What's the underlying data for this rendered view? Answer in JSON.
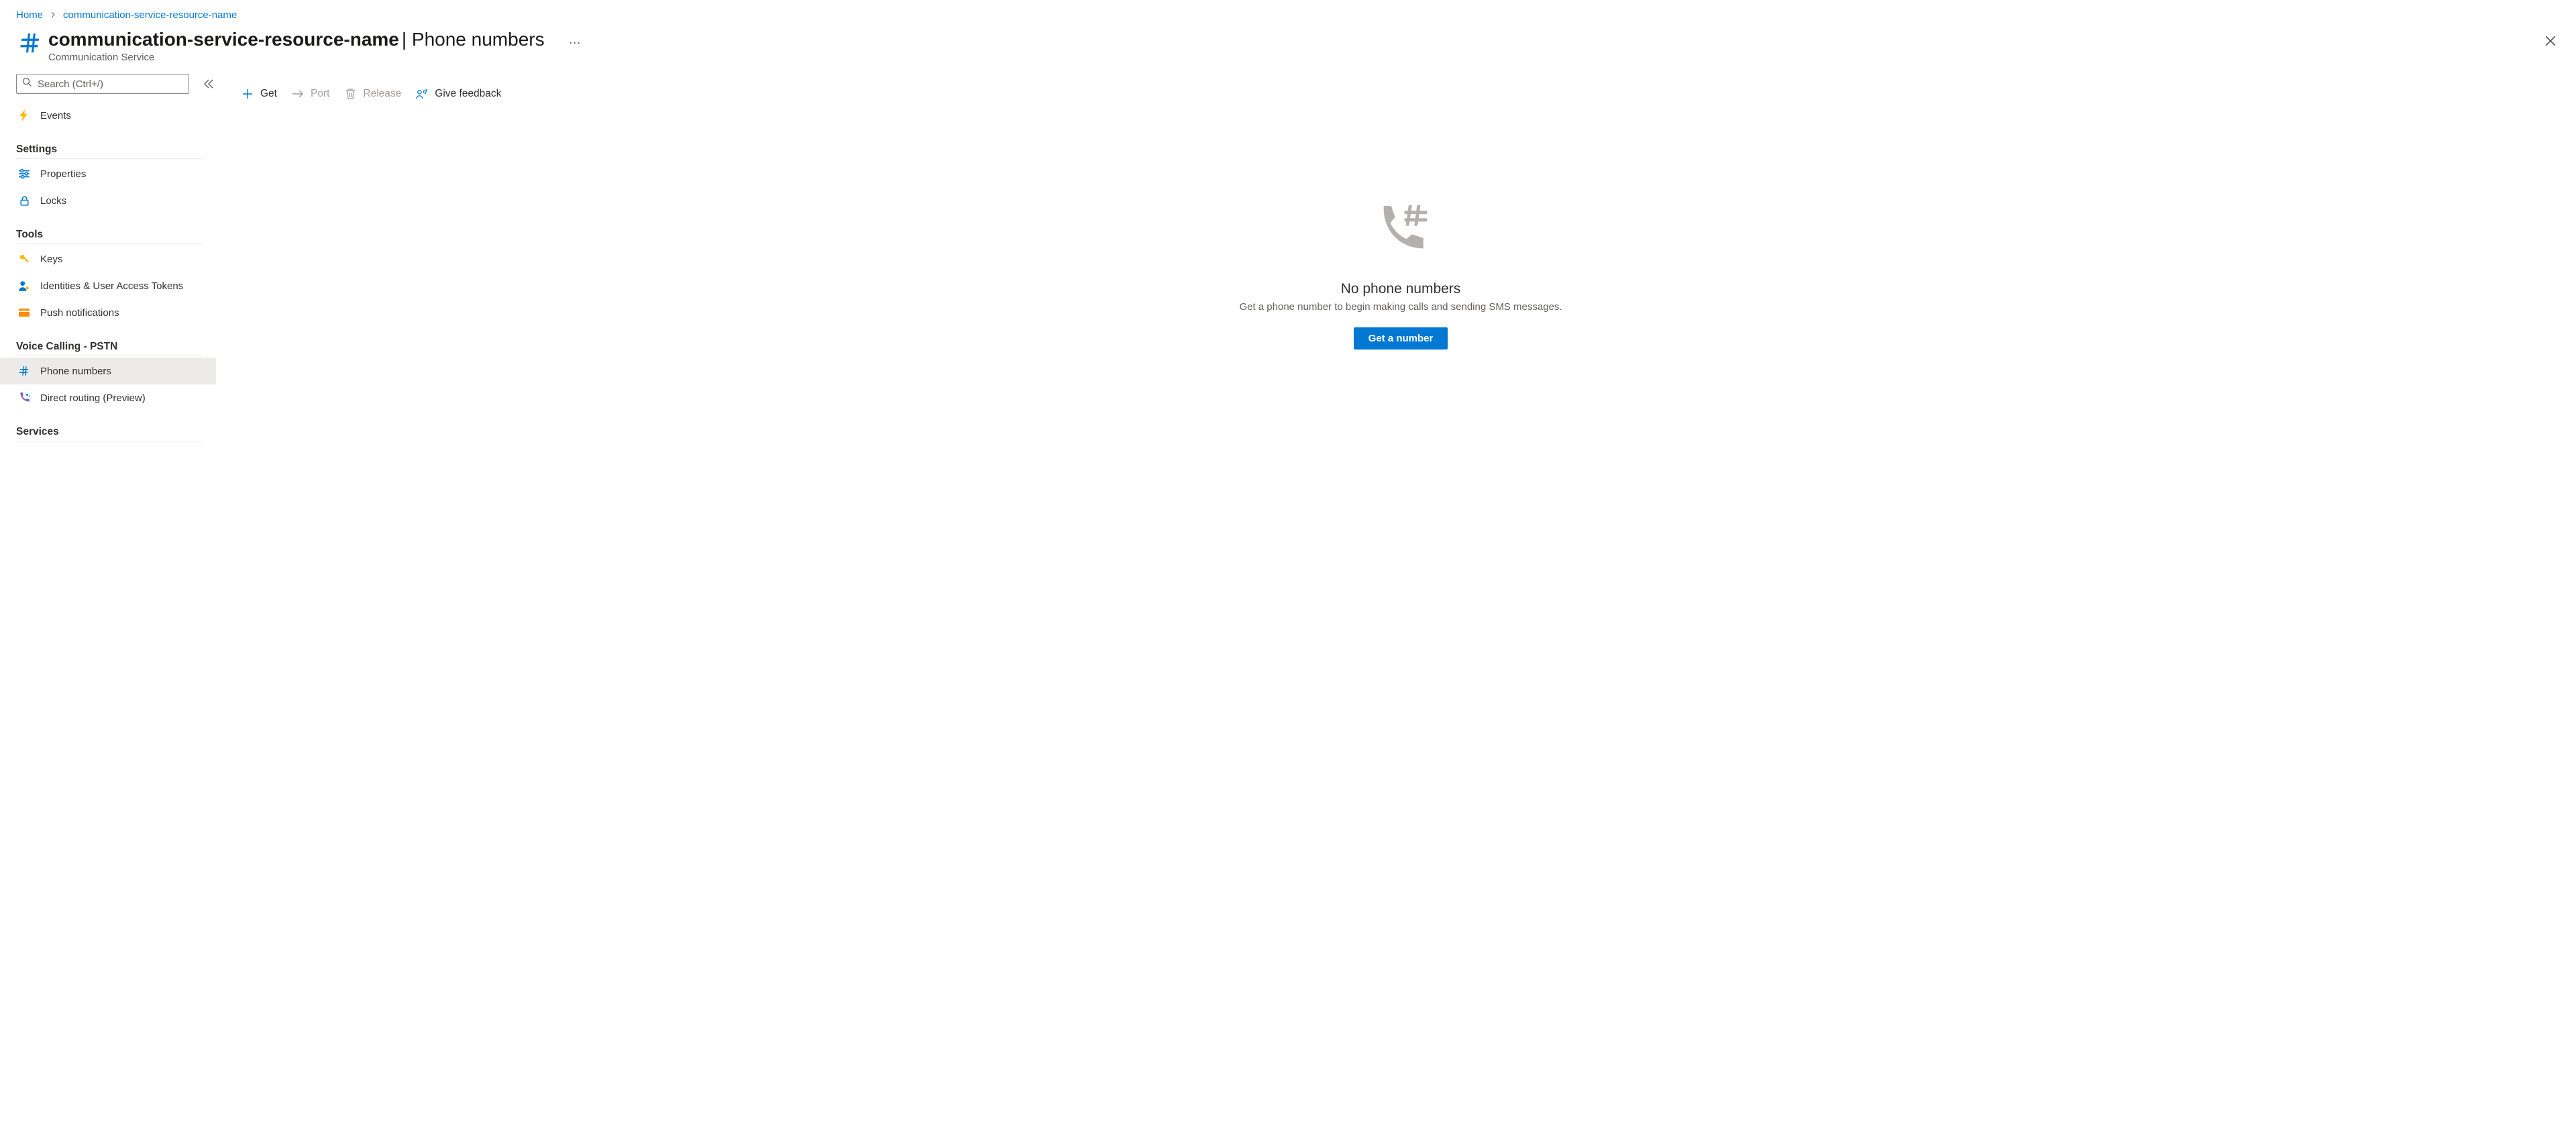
{
  "breadcrumb": {
    "home": "Home",
    "resource": "communication-service-resource-name"
  },
  "header": {
    "title_strong": "communication-service-resource-name",
    "title_suffix": " | Phone numbers",
    "subtitle": "Communication Service"
  },
  "search": {
    "placeholder": "Search (Ctrl+/)"
  },
  "nav": {
    "events": "Events",
    "group_settings": "Settings",
    "properties": "Properties",
    "locks": "Locks",
    "group_tools": "Tools",
    "keys": "Keys",
    "identities": "Identities & User Access Tokens",
    "push": "Push notifications",
    "group_voice": "Voice Calling - PSTN",
    "phone_numbers": "Phone numbers",
    "direct_routing": "Direct routing (Preview)",
    "group_services": "Services"
  },
  "toolbar": {
    "get": "Get",
    "port": "Port",
    "release": "Release",
    "feedback": "Give feedback"
  },
  "empty": {
    "title": "No phone numbers",
    "desc": "Get a phone number to begin making calls and sending SMS messages.",
    "cta": "Get a number"
  }
}
